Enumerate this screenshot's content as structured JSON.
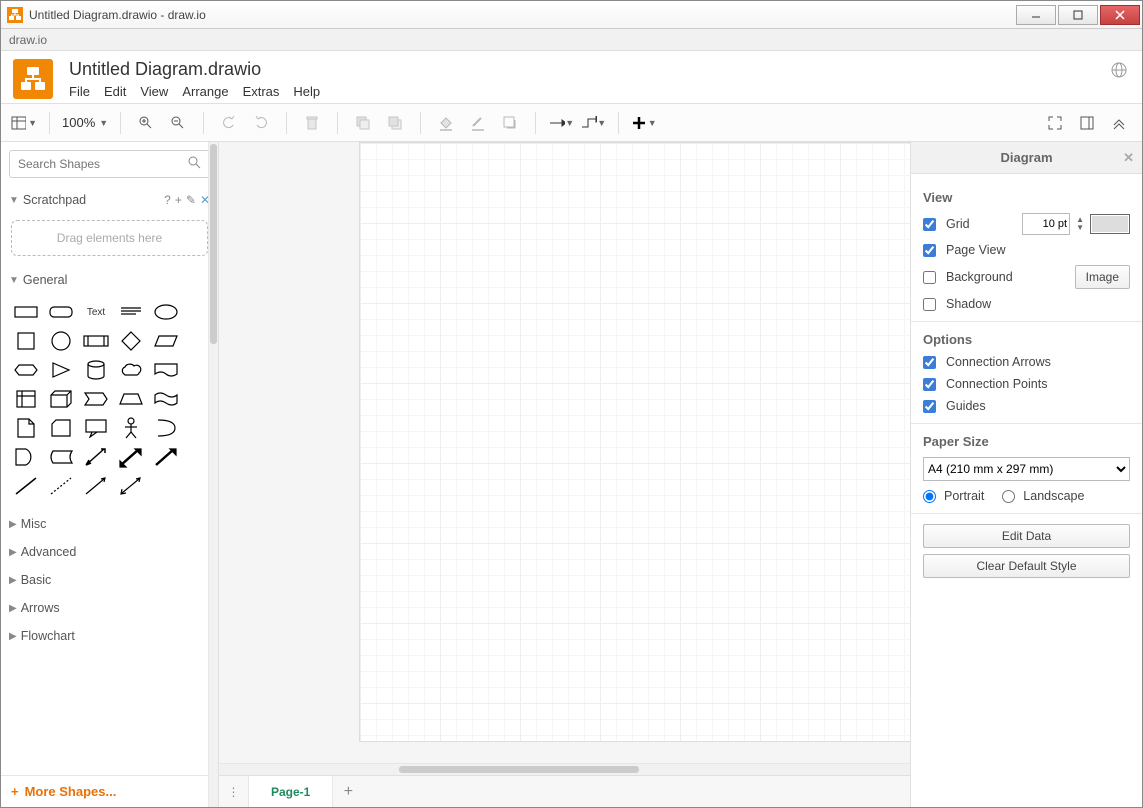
{
  "window": {
    "title": "Untitled Diagram.drawio - draw.io"
  },
  "secondary_bar": {
    "label": "draw.io"
  },
  "document": {
    "title": "Untitled Diagram.drawio"
  },
  "menus": {
    "file": "File",
    "edit": "Edit",
    "view": "View",
    "arrange": "Arrange",
    "extras": "Extras",
    "help": "Help"
  },
  "toolbar": {
    "zoom": "100%"
  },
  "left_panel": {
    "search_placeholder": "Search Shapes",
    "scratchpad_label": "Scratchpad",
    "drop_hint": "Drag elements here",
    "general_label": "General",
    "text_shape_label": "Text",
    "categories": {
      "misc": "Misc",
      "advanced": "Advanced",
      "basic": "Basic",
      "arrows": "Arrows",
      "flowchart": "Flowchart"
    },
    "more_shapes": "More Shapes..."
  },
  "tabs": {
    "page1": "Page-1"
  },
  "right_panel": {
    "title": "Diagram",
    "view_label": "View",
    "grid_label": "Grid",
    "grid_value": "10 pt",
    "pageview_label": "Page View",
    "background_label": "Background",
    "image_btn": "Image",
    "shadow_label": "Shadow",
    "options_label": "Options",
    "conn_arrows": "Connection Arrows",
    "conn_points": "Connection Points",
    "guides": "Guides",
    "paper_label": "Paper Size",
    "paper_value": "A4 (210 mm x 297 mm)",
    "portrait": "Portrait",
    "landscape": "Landscape",
    "edit_data": "Edit Data",
    "clear_style": "Clear Default Style"
  }
}
